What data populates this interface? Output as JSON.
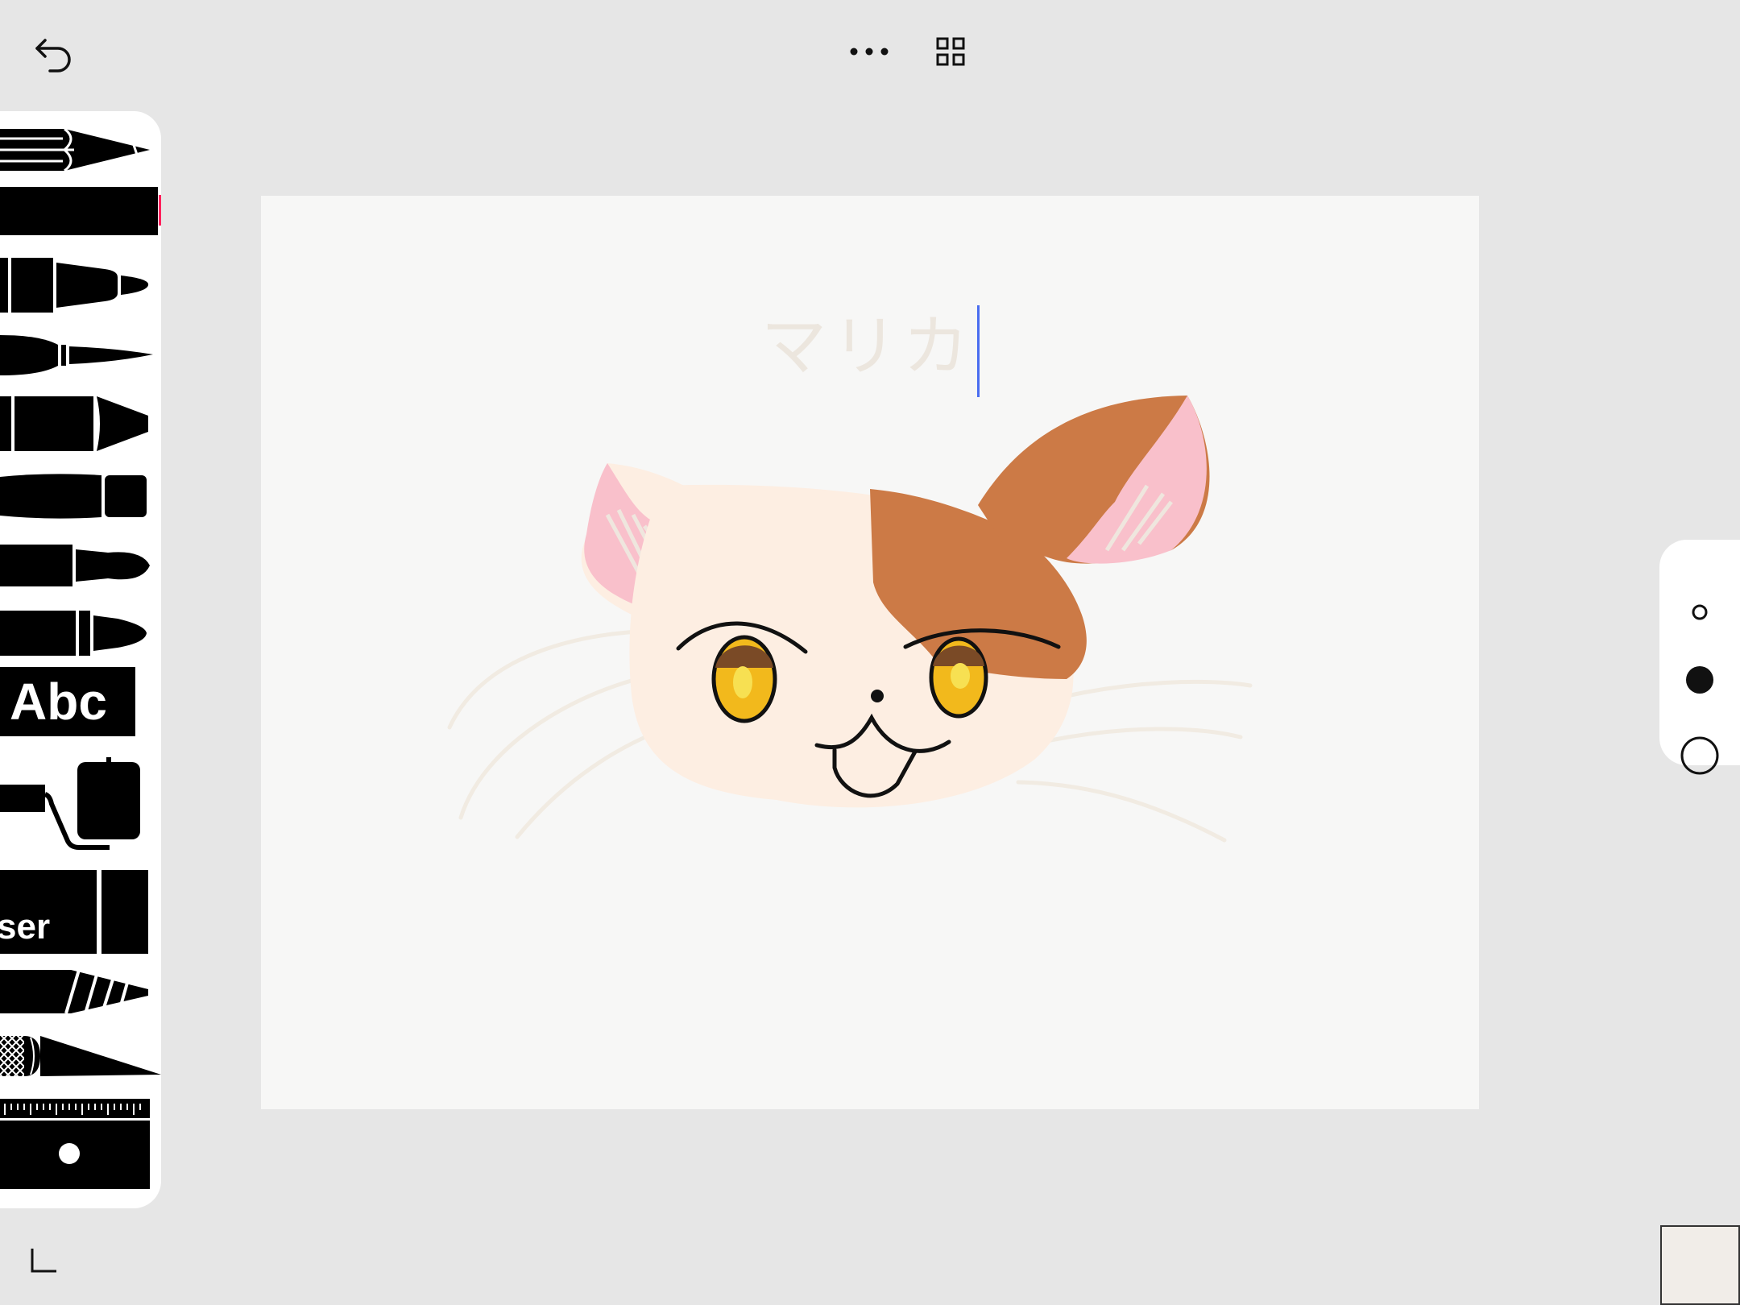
{
  "toolbar": {
    "undo_icon": "undo-icon",
    "more_icon": "more-icon",
    "gallery_icon": "grid-icon"
  },
  "tools": [
    {
      "name": "pencil-set"
    },
    {
      "name": "fineliner",
      "selected": true,
      "tip_color": "#ff1f5a"
    },
    {
      "name": "marker"
    },
    {
      "name": "fountain-pen"
    },
    {
      "name": "crayon"
    },
    {
      "name": "felt-pen"
    },
    {
      "name": "brush"
    },
    {
      "name": "watercolor-brush"
    },
    {
      "name": "text-tool",
      "label": "Abc"
    },
    {
      "name": "fill-bucket"
    },
    {
      "name": "eraser",
      "label": "ser"
    },
    {
      "name": "cutter"
    },
    {
      "name": "lasso-knife"
    },
    {
      "name": "ruler"
    }
  ],
  "canvas": {
    "title": "マリカ",
    "background": "#f7f7f6"
  },
  "size_options": [
    "small",
    "medium",
    "large"
  ],
  "selected_size": "medium",
  "current_color": "#f1ede8"
}
